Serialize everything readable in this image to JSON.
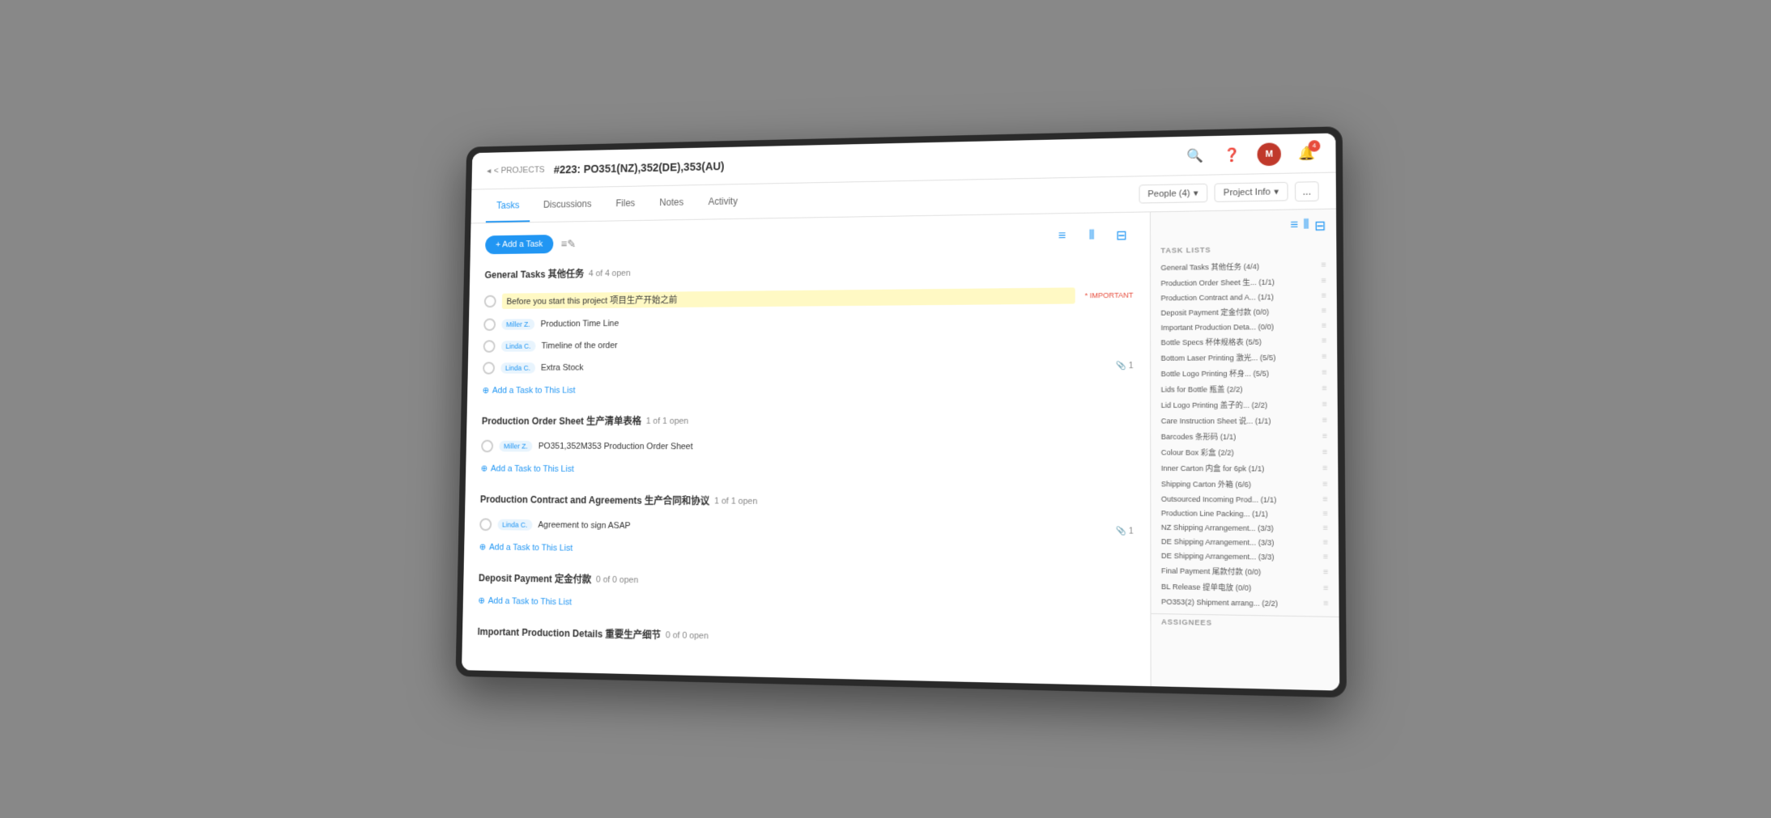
{
  "topBar": {
    "backLabel": "< PROJECTS",
    "projectTitle": "#223: PO351(NZ),352(DE),353(AU)",
    "notificationCount": "4"
  },
  "navTabs": {
    "tabs": [
      {
        "id": "tasks",
        "label": "Tasks",
        "active": true
      },
      {
        "id": "discussions",
        "label": "Discussions",
        "active": false
      },
      {
        "id": "files",
        "label": "Files",
        "active": false
      },
      {
        "id": "notes",
        "label": "Notes",
        "active": false
      },
      {
        "id": "activity",
        "label": "Activity",
        "active": false
      }
    ],
    "peopleButton": "People (4)",
    "projectInfoButton": "Project Info",
    "moreButton": "..."
  },
  "toolbar": {
    "addTaskLabel": "+ Add a Task"
  },
  "taskSections": [
    {
      "id": "general",
      "title": "General Tasks 其他任务",
      "count": "4 of 4 open",
      "tasks": [
        {
          "id": "t1",
          "name": "Before you start this project 项目生产开始之前",
          "highlighted": true,
          "badge": "* IMPORTANT",
          "assignee": null
        },
        {
          "id": "t2",
          "name": "Production Time Line",
          "highlighted": false,
          "badge": null,
          "assignee": "Miller Z."
        },
        {
          "id": "t3",
          "name": "Timeline of the order",
          "highlighted": false,
          "badge": null,
          "assignee": "Linda C."
        },
        {
          "id": "t4",
          "name": "Extra Stock",
          "highlighted": false,
          "badge": null,
          "assignee": "Linda C.",
          "attachment": "1"
        }
      ],
      "addLabel": "Add a Task to This List"
    },
    {
      "id": "production-order",
      "title": "Production Order Sheet 生产清单表格",
      "count": "1 of 1 open",
      "tasks": [
        {
          "id": "t5",
          "name": "PO351,352M353 Production Order Sheet",
          "highlighted": false,
          "badge": null,
          "assignee": "Miller Z."
        }
      ],
      "addLabel": "Add a Task to This List"
    },
    {
      "id": "production-contract",
      "title": "Production Contract and Agreements 生产合同和协议",
      "count": "1 of 1 open",
      "tasks": [
        {
          "id": "t6",
          "name": "Agreement to sign ASAP",
          "highlighted": false,
          "badge": null,
          "assignee": "Linda C.",
          "attachment": "1"
        }
      ],
      "addLabel": "Add a Task to This List"
    },
    {
      "id": "deposit",
      "title": "Deposit Payment 定金付款",
      "count": "0 of 0 open",
      "tasks": [],
      "addLabel": "Add a Task to This List"
    },
    {
      "id": "important-production",
      "title": "Important Production Details 重要生产细节",
      "count": "0 of 0 open",
      "tasks": [],
      "addLabel": null
    }
  ],
  "sidebar": {
    "viewIcons": [
      "≡",
      "|||",
      "≡"
    ],
    "taskListsTitle": "TASK LISTS",
    "taskLists": [
      {
        "name": "General Tasks 其他任务 (4/4)",
        "count": ""
      },
      {
        "name": "Production Order Sheet 生... (1/1)",
        "count": ""
      },
      {
        "name": "Production Contract and A... (1/1)",
        "count": ""
      },
      {
        "name": "Deposit Payment 定金付款 (0/0)",
        "count": ""
      },
      {
        "name": "Important Production Deta... (0/0)",
        "count": ""
      },
      {
        "name": "Bottle Specs 杯体规格表 (5/5)",
        "count": ""
      },
      {
        "name": "Bottom Laser Printing 激光... (5/5)",
        "count": ""
      },
      {
        "name": "Bottle Logo Printing 杯身... (5/5)",
        "count": ""
      },
      {
        "name": "Lids for Bottle 瓶盖 (2/2)",
        "count": ""
      },
      {
        "name": "Lid Logo Printing 盖子的... (2/2)",
        "count": ""
      },
      {
        "name": "Care Instruction Sheet 说... (1/1)",
        "count": ""
      },
      {
        "name": "Barcodes 条形码 (1/1)",
        "count": ""
      },
      {
        "name": "Colour Box 彩盒 (2/2)",
        "count": ""
      },
      {
        "name": "Inner Carton 内盒 for 6pk (1/1)",
        "count": ""
      },
      {
        "name": "Shipping Carton 外箱 (6/6)",
        "count": ""
      },
      {
        "name": "Outsourced Incoming Prod... (1/1)",
        "count": ""
      },
      {
        "name": "Production Line Packing... (1/1)",
        "count": ""
      },
      {
        "name": "NZ Shipping Arrangement... (3/3)",
        "count": ""
      },
      {
        "name": "DE Shipping Arrangement... (3/3)",
        "count": ""
      },
      {
        "name": "DE Shipping Arrangement... (3/3)",
        "count": ""
      },
      {
        "name": "Final Payment 尾款付款 (0/0)",
        "count": ""
      },
      {
        "name": "BL Release 提单电放 (0/0)",
        "count": ""
      },
      {
        "name": "PO353(2) Shipment arrang... (2/2)",
        "count": ""
      }
    ],
    "assigneesTitle": "ASSIGNEES"
  }
}
